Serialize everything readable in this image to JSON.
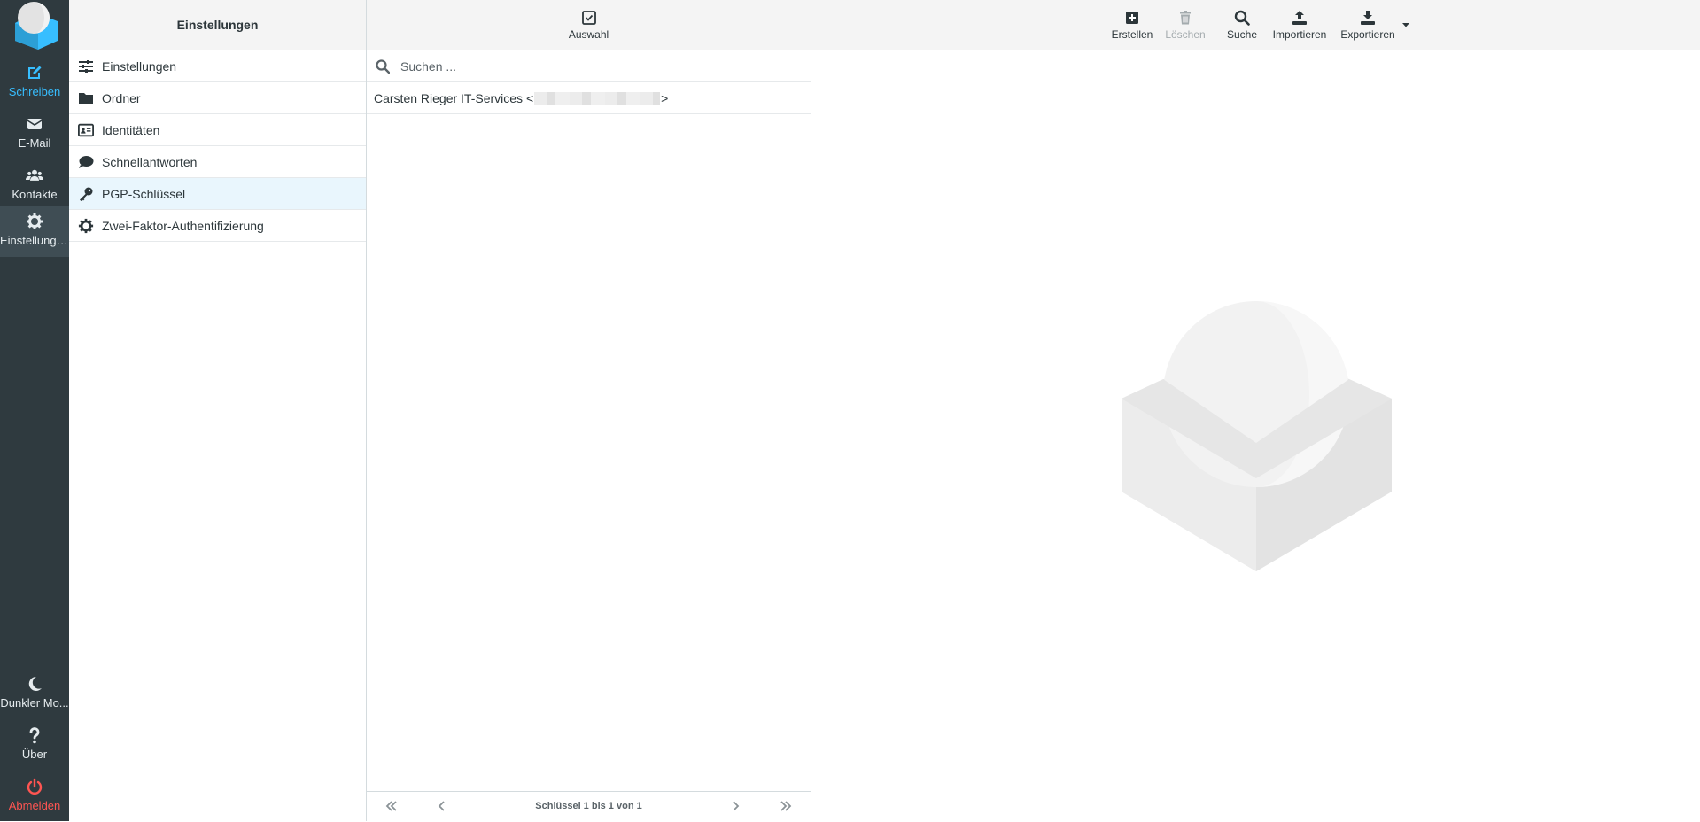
{
  "nav": {
    "items": [
      {
        "label": "Schreiben",
        "icon": "compose-icon"
      },
      {
        "label": "E-Mail",
        "icon": "envelope-icon"
      },
      {
        "label": "Kontakte",
        "icon": "users-icon"
      },
      {
        "label": "Einstellungen",
        "icon": "gear-icon"
      }
    ],
    "bottom": [
      {
        "label": "Dunkler Mo...",
        "icon": "moon-icon"
      },
      {
        "label": "Über",
        "icon": "question-icon"
      },
      {
        "label": "Abmelden",
        "icon": "power-icon"
      }
    ]
  },
  "settings": {
    "title": "Einstellungen",
    "items": [
      {
        "label": "Einstellungen",
        "icon": "sliders-icon"
      },
      {
        "label": "Ordner",
        "icon": "folder-icon"
      },
      {
        "label": "Identitäten",
        "icon": "id-card-icon"
      },
      {
        "label": "Schnellantworten",
        "icon": "comment-icon"
      },
      {
        "label": "PGP-Schlüssel",
        "icon": "key-icon",
        "selected": true
      },
      {
        "label": "Zwei-Faktor-Authentifizierung",
        "icon": "gear-icon"
      }
    ]
  },
  "keys": {
    "select_label": "Auswahl",
    "search_placeholder": "Suchen ...",
    "rows": [
      {
        "name": "Carsten Rieger IT-Services",
        "email_open": "<",
        "email_close": ">"
      }
    ],
    "page_status": "Schlüssel 1 bis 1 von 1"
  },
  "toolbar": {
    "create": "Erstellen",
    "delete": "Löschen",
    "search": "Suche",
    "import": "Importieren",
    "export": "Exportieren"
  },
  "colors": {
    "nav_bg": "#2f3a3f",
    "accent": "#37beff",
    "logout": "#ff5552",
    "selected_row": "#e9f6fd"
  }
}
